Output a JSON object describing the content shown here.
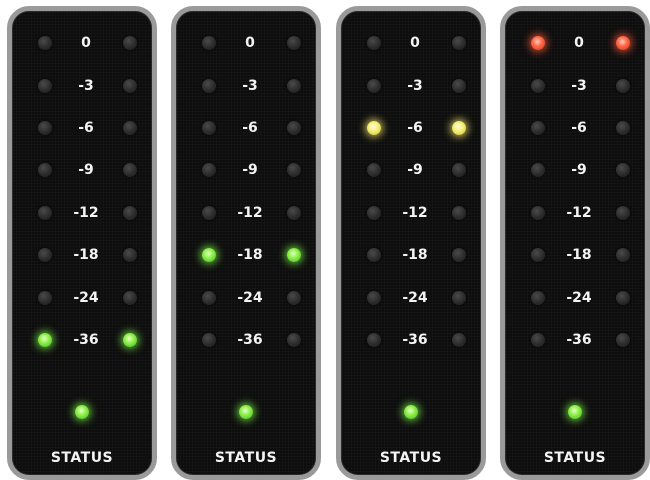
{
  "colors": {
    "led_off": "#2b2b2b",
    "led_green": "#8ef04a",
    "led_yellow": "#f7ef7a",
    "led_red": "#ff6a4a",
    "panel_background": "#0d0d0d",
    "panel_border": "#9a9a9a",
    "label_text": "#f4f4f4"
  },
  "meters": [
    {
      "scale": [
        {
          "label": "0",
          "left": "off",
          "right": "off"
        },
        {
          "label": "-3",
          "left": "off",
          "right": "off"
        },
        {
          "label": "-6",
          "left": "off",
          "right": "off"
        },
        {
          "label": "-9",
          "left": "off",
          "right": "off"
        },
        {
          "label": "-12",
          "left": "off",
          "right": "off"
        },
        {
          "label": "-18",
          "left": "off",
          "right": "off"
        },
        {
          "label": "-24",
          "left": "off",
          "right": "off"
        },
        {
          "label": "-36",
          "left": "green",
          "right": "green"
        }
      ],
      "status_label": "STATUS",
      "status_led": "green"
    },
    {
      "scale": [
        {
          "label": "0",
          "left": "off",
          "right": "off"
        },
        {
          "label": "-3",
          "left": "off",
          "right": "off"
        },
        {
          "label": "-6",
          "left": "off",
          "right": "off"
        },
        {
          "label": "-9",
          "left": "off",
          "right": "off"
        },
        {
          "label": "-12",
          "left": "off",
          "right": "off"
        },
        {
          "label": "-18",
          "left": "green",
          "right": "green"
        },
        {
          "label": "-24",
          "left": "off",
          "right": "off"
        },
        {
          "label": "-36",
          "left": "off",
          "right": "off"
        }
      ],
      "status_label": "STATUS",
      "status_led": "green"
    },
    {
      "scale": [
        {
          "label": "0",
          "left": "off",
          "right": "off"
        },
        {
          "label": "-3",
          "left": "off",
          "right": "off"
        },
        {
          "label": "-6",
          "left": "yellow",
          "right": "yellow"
        },
        {
          "label": "-9",
          "left": "off",
          "right": "off"
        },
        {
          "label": "-12",
          "left": "off",
          "right": "off"
        },
        {
          "label": "-18",
          "left": "off",
          "right": "off"
        },
        {
          "label": "-24",
          "left": "off",
          "right": "off"
        },
        {
          "label": "-36",
          "left": "off",
          "right": "off"
        }
      ],
      "status_label": "STATUS",
      "status_led": "green"
    },
    {
      "scale": [
        {
          "label": "0",
          "left": "red",
          "right": "red"
        },
        {
          "label": "-3",
          "left": "off",
          "right": "off"
        },
        {
          "label": "-6",
          "left": "off",
          "right": "off"
        },
        {
          "label": "-9",
          "left": "off",
          "right": "off"
        },
        {
          "label": "-12",
          "left": "off",
          "right": "off"
        },
        {
          "label": "-18",
          "left": "off",
          "right": "off"
        },
        {
          "label": "-24",
          "left": "off",
          "right": "off"
        },
        {
          "label": "-36",
          "left": "off",
          "right": "off"
        }
      ],
      "status_label": "STATUS",
      "status_led": "green"
    }
  ]
}
